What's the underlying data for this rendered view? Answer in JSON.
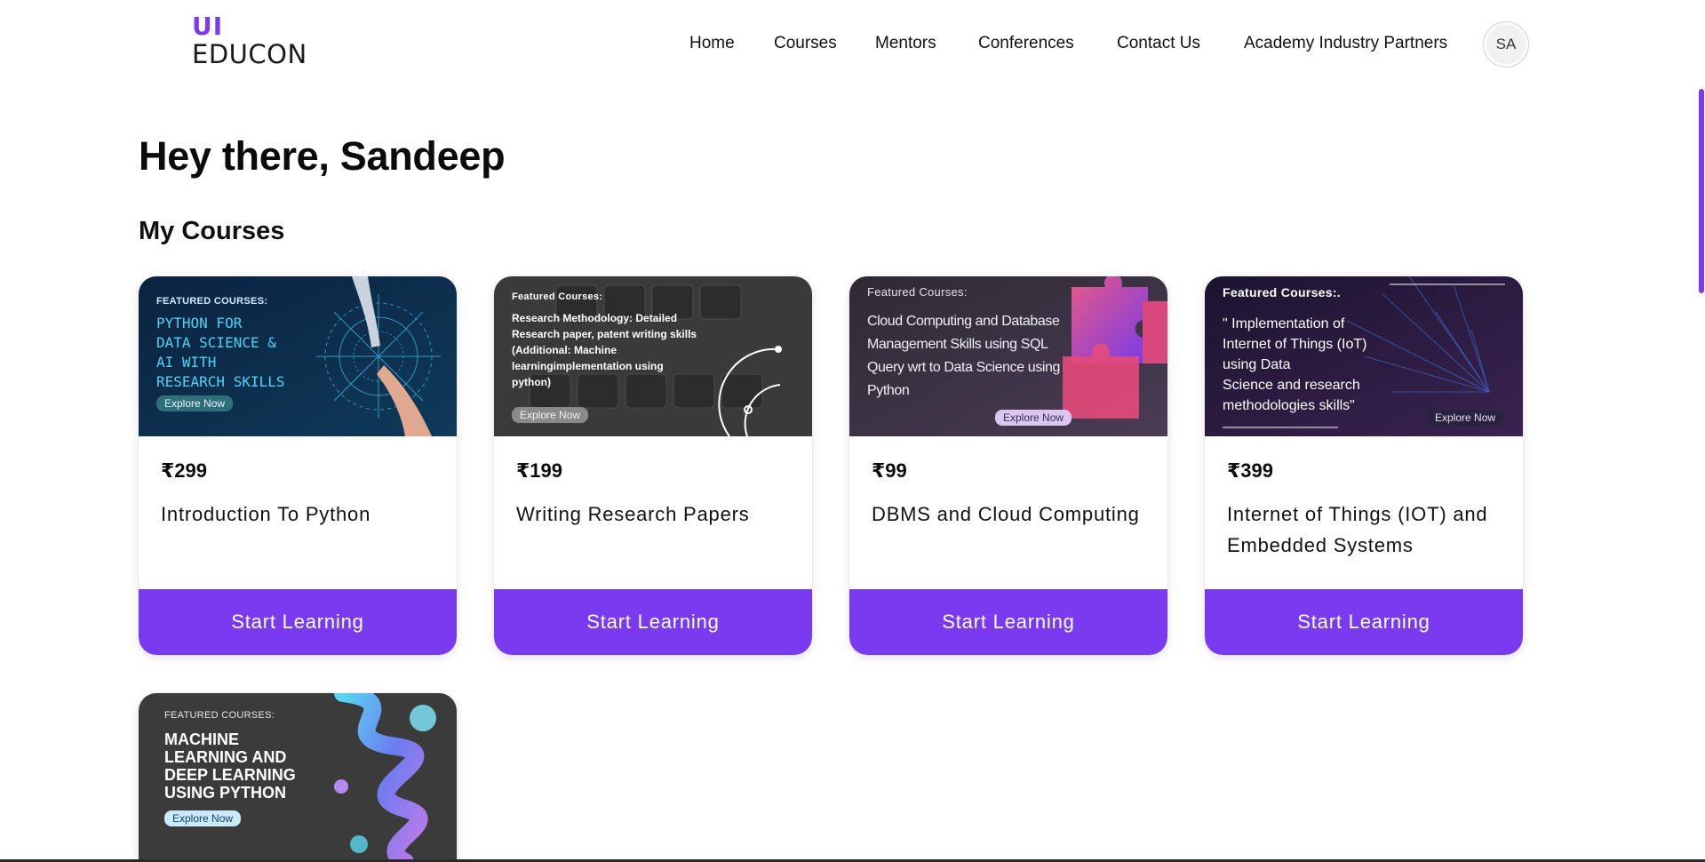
{
  "brand": {
    "mark": "UI",
    "name": "EDUCON",
    "accent": "#7c3aed"
  },
  "nav": {
    "items": [
      "Home",
      "Courses",
      "Mentors",
      "Conferences",
      "Contact Us",
      "Academy Industry Partners"
    ],
    "avatar_initials": "SA"
  },
  "greeting": "Hey there, Sandeep",
  "section_title": "My Courses",
  "courses": [
    {
      "thumb_label": "FEATURED COURSES:",
      "thumb_title": "PYTHON FOR\nDATA SCIENCE &\nAI WITH\nRESEARCH SKILLS",
      "explore": "Explore Now",
      "price": "₹299",
      "name": "Introduction To Python",
      "button": "Start Learning"
    },
    {
      "thumb_label": "Featured Courses:",
      "thumb_title": "Research Methodology: Detailed\nResearch paper, patent writing skills\n(Additional: Machine\nlearningimplementation using\npython)",
      "explore": "Explore Now",
      "price": "₹199",
      "name": "Writing Research Papers",
      "button": "Start Learning"
    },
    {
      "thumb_label": "Featured Courses:",
      "thumb_title": "Cloud Computing and Database\nManagement Skills using SQL\nQuery wrt to Data Science using\nPython",
      "explore": "Explore Now",
      "price": "₹99",
      "name": "DBMS and Cloud Computing",
      "button": "Start Learning"
    },
    {
      "thumb_label": "Featured Courses:.",
      "thumb_title": "\" Implementation of\nInternet of Things (IoT)\nusing Data\nScience and research\nmethodologies skills\"",
      "explore": "Explore Now",
      "price": "₹399",
      "name": "Internet of Things (IOT) and Embedded Systems",
      "button": "Start Learning"
    },
    {
      "thumb_label": "FEATURED COURSES:",
      "thumb_title": "MACHINE\nLEARNING AND\nDEEP LEARNING\nUSING PYTHON",
      "explore": "Explore Now"
    }
  ],
  "colors": {
    "primary_button": "#7a3bf0",
    "card1_bg": "#0c2a45",
    "card2_bg": "#3a3a3a",
    "card3_bg": "#3a3442",
    "card4_bg": "#24183a",
    "card5_bg": "#3b3b3b"
  },
  "icons": {
    "thumb1": "robot-hand-network-graphic",
    "thumb2": "keyboard-graphic",
    "thumb3": "puzzle-pieces-graphic",
    "thumb4": "network-lines-graphic",
    "thumb5": "3d-spiral-graphic"
  }
}
